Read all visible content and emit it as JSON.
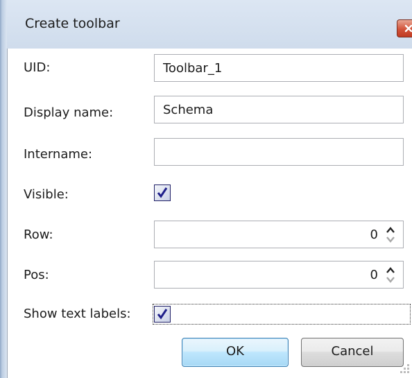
{
  "window": {
    "title": "Create toolbar"
  },
  "form": {
    "uid": {
      "label": "UID:",
      "value": "Toolbar_1"
    },
    "display_name": {
      "label": "Display name:",
      "value": "Schema"
    },
    "intername": {
      "label": "Intername:",
      "value": ""
    },
    "visible": {
      "label": "Visible:",
      "checked": true
    },
    "row": {
      "label": "Row:",
      "value": "0"
    },
    "pos": {
      "label": "Pos:",
      "value": "0"
    },
    "show_text_labels": {
      "label": "Show text labels:",
      "checked": true
    }
  },
  "buttons": {
    "ok_label": "OK",
    "cancel_label": "Cancel"
  },
  "icons": {
    "close": "close-icon",
    "checkmark": "checkmark-icon",
    "spin_up": "chevron-up-icon",
    "spin_down": "chevron-down-icon",
    "resize": "resize-grip-icon"
  },
  "colors": {
    "titlebar": "#cfdcec",
    "close_button": "#d2533a",
    "ok_button_border": "#3c7fb1",
    "checkbox_border": "#1f1f66"
  }
}
